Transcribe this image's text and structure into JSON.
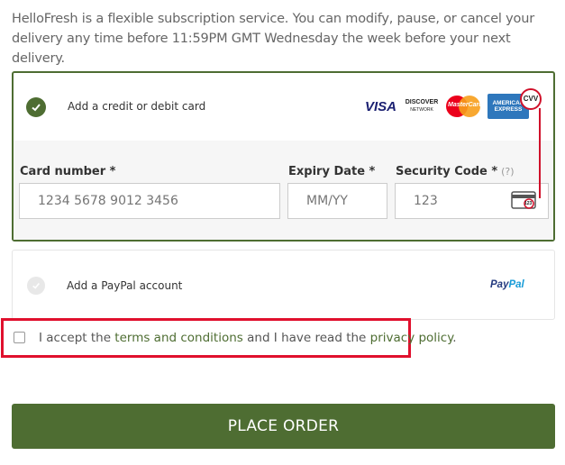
{
  "intro": {
    "text": "HelloFresh is a flexible subscription service. You can modify, pause, or cancel your delivery any time before 11:59PM GMT Wednesday the week before your next delivery."
  },
  "card_option": {
    "label": "Add a credit or debit card",
    "selected": true,
    "logos": {
      "visa": "VISA",
      "discover_top": "DISCOVER",
      "discover_bottom": "NETWORK",
      "mastercard": "MasterCard",
      "amex_top": "AMERICAN",
      "amex_bottom": "EXPRESS"
    },
    "fields": {
      "card_number": {
        "label": "Card number *",
        "placeholder": "1234 5678 9012 3456"
      },
      "expiry": {
        "label": "Expiry Date *",
        "placeholder": "MM/YY"
      },
      "security": {
        "label": "Security Code *",
        "hint": "(?)",
        "placeholder": "123",
        "cvv_callout": "CVV",
        "cvv_digits": "123"
      }
    }
  },
  "paypal_option": {
    "label": "Add a PayPal account",
    "selected": false,
    "logo_pay": "Pay",
    "logo_pal": "Pal"
  },
  "terms": {
    "text_before": "I accept the ",
    "terms_link": "terms and conditions",
    "text_middle": " and I have read the ",
    "privacy_link": "privacy policy",
    "text_after": ".",
    "checked": false
  },
  "actions": {
    "place_order": "PLACE ORDER"
  },
  "colors": {
    "brand_green": "#4e6d32",
    "highlight_red": "#e0102d"
  }
}
